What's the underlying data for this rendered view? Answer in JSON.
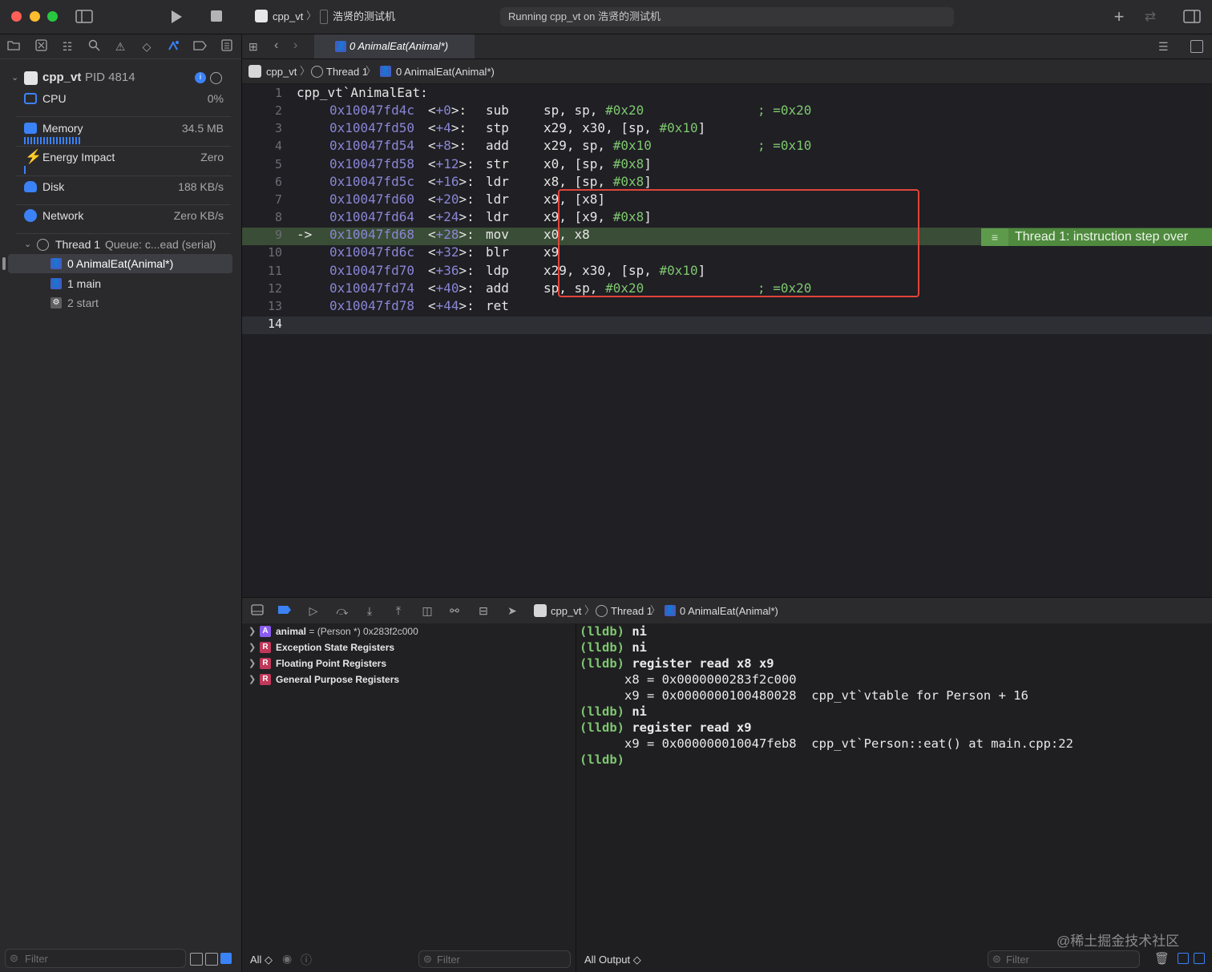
{
  "window": {
    "scheme": "cpp_vt",
    "device": "浩贤的测试机",
    "status": "Running cpp_vt on 浩贤的测试机"
  },
  "tab": {
    "label": "0 AnimalEat(Animal*)"
  },
  "jumpbar": {
    "project": "cpp_vt",
    "thread": "Thread 1",
    "frame": "0 AnimalEat(Animal*)"
  },
  "navigator": {
    "process": {
      "name": "cpp_vt",
      "pid": "PID 4814"
    },
    "gauges": [
      {
        "label": "CPU",
        "value": "0%"
      },
      {
        "label": "Memory",
        "value": "34.5 MB"
      },
      {
        "label": "Energy Impact",
        "value": "Zero"
      },
      {
        "label": "Disk",
        "value": "188 KB/s"
      },
      {
        "label": "Network",
        "value": "Zero KB/s"
      }
    ],
    "thread": {
      "name": "Thread 1",
      "queue": "Queue: c...ead (serial)"
    },
    "frames": [
      "0 AnimalEat(Animal*)",
      "1 main",
      "2 start"
    ],
    "filter_placeholder": "Filter"
  },
  "disassembly": {
    "header": "cpp_vt`AnimalEat:",
    "lines": [
      {
        "n": "1"
      },
      {
        "n": "2",
        "addr": "0x10047fd4c",
        "off": "+0",
        "mnem": "sub",
        "ops": "sp, sp, ",
        "imm": "#0x20",
        "tail": "",
        "cmt": "; =0x20"
      },
      {
        "n": "3",
        "addr": "0x10047fd50",
        "off": "+4",
        "mnem": "stp",
        "ops": "x29, x30, [sp, ",
        "imm": "#0x10",
        "tail": "]",
        "cmt": ""
      },
      {
        "n": "4",
        "addr": "0x10047fd54",
        "off": "+8",
        "mnem": "add",
        "ops": "x29, sp, ",
        "imm": "#0x10",
        "tail": "",
        "cmt": "; =0x10"
      },
      {
        "n": "5",
        "addr": "0x10047fd58",
        "off": "+12",
        "mnem": "str",
        "ops": "x0, [sp, ",
        "imm": "#0x8",
        "tail": "]",
        "cmt": ""
      },
      {
        "n": "6",
        "addr": "0x10047fd5c",
        "off": "+16",
        "mnem": "ldr",
        "ops": "x8, [sp, ",
        "imm": "#0x8",
        "tail": "]",
        "cmt": ""
      },
      {
        "n": "7",
        "addr": "0x10047fd60",
        "off": "+20",
        "mnem": "ldr",
        "ops": "x9, [x8]",
        "imm": "",
        "tail": "",
        "cmt": ""
      },
      {
        "n": "8",
        "addr": "0x10047fd64",
        "off": "+24",
        "mnem": "ldr",
        "ops": "x9, [x9, ",
        "imm": "#0x8",
        "tail": "]",
        "cmt": ""
      },
      {
        "n": "9",
        "arrow": "->",
        "addr": "0x10047fd68",
        "off": "+28",
        "mnem": "mov",
        "ops": "x0, x8",
        "imm": "",
        "tail": "",
        "cmt": ""
      },
      {
        "n": "10",
        "addr": "0x10047fd6c",
        "off": "+32",
        "mnem": "blr",
        "ops": "x9",
        "imm": "",
        "tail": "",
        "cmt": ""
      },
      {
        "n": "11",
        "addr": "0x10047fd70",
        "off": "+36",
        "mnem": "ldp",
        "ops": "x29, x30, [sp, ",
        "imm": "#0x10",
        "tail": "]",
        "cmt": ""
      },
      {
        "n": "12",
        "addr": "0x10047fd74",
        "off": "+40",
        "mnem": "add",
        "ops": "sp, sp, ",
        "imm": "#0x20",
        "tail": "",
        "cmt": "; =0x20"
      },
      {
        "n": "13",
        "addr": "0x10047fd78",
        "off": "+44",
        "mnem": "ret",
        "ops": "",
        "imm": "",
        "tail": "",
        "cmt": ""
      },
      {
        "n": "14"
      }
    ],
    "step_badge": "Thread 1: instruction step over"
  },
  "variables": [
    {
      "badge": "A",
      "name": "animal",
      "rest": " = (Person *) 0x283f2c000"
    },
    {
      "badge": "R",
      "name": "Exception State Registers",
      "rest": ""
    },
    {
      "badge": "R",
      "name": "Floating Point Registers",
      "rest": ""
    },
    {
      "badge": "R",
      "name": "General Purpose Registers",
      "rest": ""
    }
  ],
  "console": {
    "lines": [
      {
        "prompt": "(lldb)",
        "text": " ni"
      },
      {
        "prompt": "(lldb)",
        "text": " ni"
      },
      {
        "prompt": "(lldb)",
        "text": " register read x8 x9"
      },
      {
        "prompt": "",
        "text": "      x8 = 0x0000000283f2c000"
      },
      {
        "prompt": "",
        "text": "      x9 = 0x0000000100480028  cpp_vt`vtable for Person + 16"
      },
      {
        "prompt": "(lldb)",
        "text": " ni"
      },
      {
        "prompt": "(lldb)",
        "text": " register read x9"
      },
      {
        "prompt": "",
        "text": "      x9 = 0x000000010047feb8  cpp_vt`Person::eat() at main.cpp:22"
      },
      {
        "prompt": "(lldb)",
        "text": ""
      }
    ]
  },
  "bottom": {
    "scope": "All ◇",
    "output": "All Output ◇",
    "filter_placeholder": "Filter",
    "watermark": "@稀土掘金技术社区"
  },
  "colors": {
    "accent": "#3d5fc4",
    "highlight_box": "#e0453a",
    "step_green": "#4f8a3f",
    "prompt_green": "#7fc76f",
    "address_purple": "#8a86d6"
  }
}
